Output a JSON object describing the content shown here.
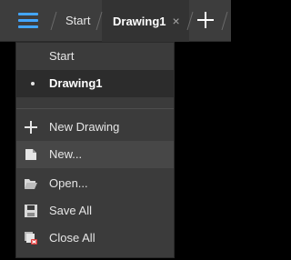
{
  "tabs": [
    {
      "label": "Start"
    },
    {
      "label": "Drawing1",
      "close": "×"
    }
  ],
  "menu": {
    "recent": [
      {
        "label": "Start",
        "bullet": false
      },
      {
        "label": "Drawing1",
        "bullet": true
      }
    ],
    "actions": [
      {
        "label": "New Drawing",
        "icon": "plus-icon"
      },
      {
        "label": "New...",
        "icon": "new-document-icon"
      },
      {
        "label": "Open...",
        "icon": "open-folder-icon"
      },
      {
        "label": "Save All",
        "icon": "save-all-icon"
      },
      {
        "label": "Close All",
        "icon": "close-all-icon"
      }
    ]
  },
  "colors": {
    "accent": "#44a6ff",
    "tabbar_bg": "#3d3d3d",
    "menu_bg": "#3b3b3b",
    "canvas_bg": "#000000"
  }
}
